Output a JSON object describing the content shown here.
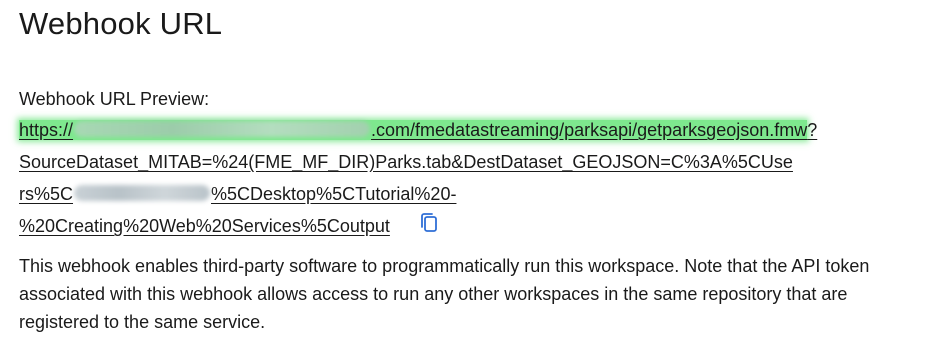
{
  "header": {
    "title": "Webhook URL"
  },
  "preview": {
    "label": "Webhook URL Preview:",
    "url_lines": {
      "line1_prefix": "https://",
      "line1_suffix": ".com/fmedatastreaming/parksapi/getparksgeojson.fmw",
      "line1_trailing": "?",
      "line2": "SourceDataset_MITAB=%24(FME_MF_DIR)Parks.tab&DestDataset_GEOJSON=C%3A%5CUse",
      "line3_prefix": "rs%5C",
      "line3_suffix": "%5CDesktop%5CTutorial%20-",
      "line4": "%20Creating%20Web%20Services%5Coutput"
    },
    "highlight_color": "#7ee88e",
    "copy_icon": "copy-icon",
    "copy_icon_color": "#2f6fd6"
  },
  "description": {
    "text": "This webhook enables third-party software to programmatically run this workspace. Note that the API token associated with this webhook allows access to run any other workspaces in the same repository that are registered to the same service."
  }
}
